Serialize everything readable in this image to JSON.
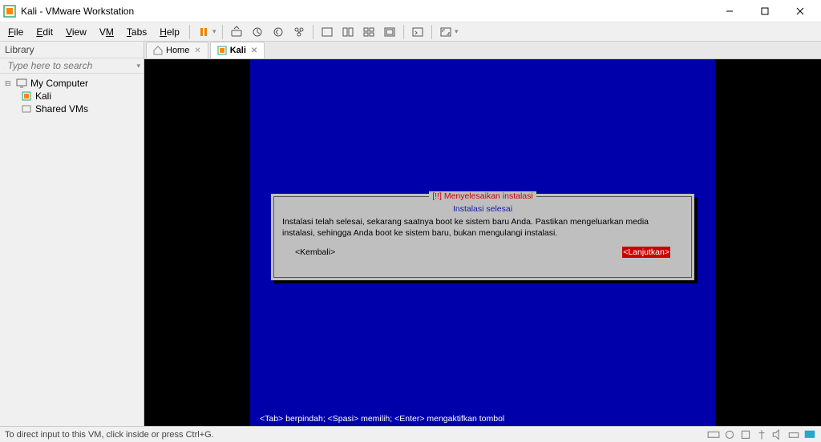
{
  "window": {
    "title": "Kali - VMware Workstation"
  },
  "menu": {
    "file": "File",
    "edit": "Edit",
    "view": "View",
    "vm": "VM",
    "tabs": "Tabs",
    "help": "Help"
  },
  "sidebar": {
    "header": "Library",
    "search_placeholder": "Type here to search",
    "tree": {
      "root": "My Computer",
      "items": [
        "Kali",
        "Shared VMs"
      ]
    }
  },
  "tabs": [
    {
      "label": "Home",
      "active": false
    },
    {
      "label": "Kali",
      "active": true
    }
  ],
  "installer": {
    "title": "[!!] Menyelesaikan instalasi",
    "subtitle": "Instalasi selesai",
    "body": "Instalasi telah selesai, sekarang saatnya boot ke sistem baru Anda. Pastikan mengeluarkan media instalasi, sehingga Anda boot ke sistem baru, bukan mengulangi instalasi.",
    "back": "<Kembali>",
    "continue": "<Lanjutkan>",
    "hint": "<Tab> berpindah; <Spasi> memilih; <Enter> mengaktifkan tombol"
  },
  "status": {
    "text": "To direct input to this VM, click inside or press Ctrl+G."
  }
}
